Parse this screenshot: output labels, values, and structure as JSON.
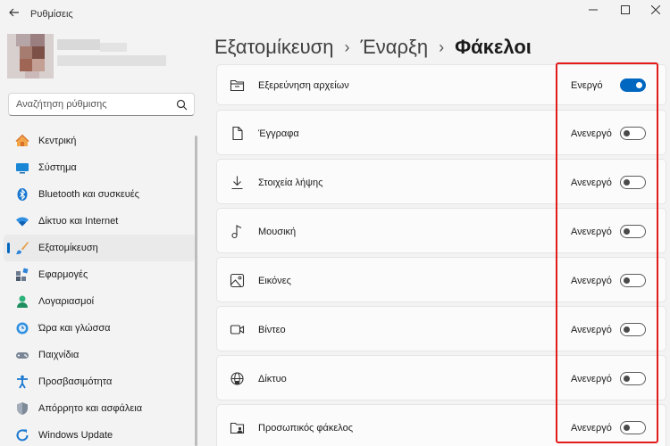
{
  "window": {
    "app_title": "Ρυθμίσεις",
    "controls": [
      "minimize-icon",
      "maximize-icon",
      "close-icon"
    ]
  },
  "search": {
    "placeholder": "Αναζήτηση ρύθμισης"
  },
  "sidebar": {
    "items": [
      {
        "label": "Κεντρική",
        "icon": "home-icon"
      },
      {
        "label": "Σύστημα",
        "icon": "system-icon"
      },
      {
        "label": "Bluetooth και συσκευές",
        "icon": "bluetooth-icon"
      },
      {
        "label": "Δίκτυο και Internet",
        "icon": "wifi-icon"
      },
      {
        "label": "Εξατομίκευση",
        "icon": "brush-icon",
        "active": true
      },
      {
        "label": "Εφαρμογές",
        "icon": "apps-icon"
      },
      {
        "label": "Λογαριασμοί",
        "icon": "accounts-icon"
      },
      {
        "label": "Ώρα και γλώσσα",
        "icon": "time-language-icon"
      },
      {
        "label": "Παιχνίδια",
        "icon": "gaming-icon"
      },
      {
        "label": "Προσβασιμότητα",
        "icon": "accessibility-icon"
      },
      {
        "label": "Απόρρητο και ασφάλεια",
        "icon": "shield-icon"
      },
      {
        "label": "Windows Update",
        "icon": "update-icon"
      }
    ]
  },
  "breadcrumb": {
    "level1": "Εξατομίκευση",
    "level2": "Έναρξη",
    "current": "Φάκελοι",
    "separator": "›"
  },
  "folders": [
    {
      "label": "Εξερεύνηση αρχείων",
      "icon": "file-explorer-icon",
      "state": "Ενεργό",
      "on": true
    },
    {
      "label": "Έγγραφα",
      "icon": "document-icon",
      "state": "Ανενεργό",
      "on": false
    },
    {
      "label": "Στοιχεία λήψης",
      "icon": "download-icon",
      "state": "Ανενεργό",
      "on": false
    },
    {
      "label": "Μουσική",
      "icon": "music-icon",
      "state": "Ανενεργό",
      "on": false
    },
    {
      "label": "Εικόνες",
      "icon": "pictures-icon",
      "state": "Ανενεργό",
      "on": false
    },
    {
      "label": "Βίντεο",
      "icon": "video-icon",
      "state": "Ανενεργό",
      "on": false
    },
    {
      "label": "Δίκτυο",
      "icon": "network-icon",
      "state": "Ανενεργό",
      "on": false
    },
    {
      "label": "Προσωπικός φάκελος",
      "icon": "personal-folder-icon",
      "state": "Ανενεργό",
      "on": false
    }
  ],
  "colors": {
    "accent": "#0067c0",
    "highlight": "#e31b1b",
    "background": "#f3f3f3",
    "card": "#fbfbfb"
  }
}
